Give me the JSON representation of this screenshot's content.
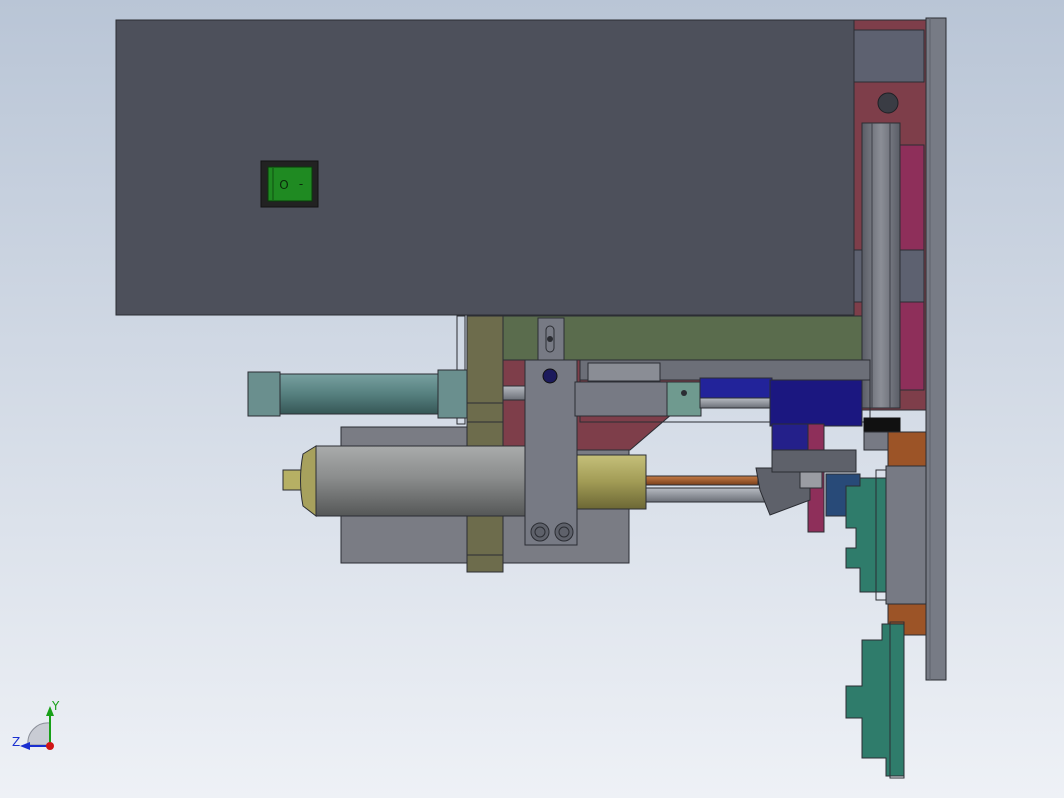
{
  "colors": {
    "background_top": "#b7c3d4",
    "background_bottom": "#eef1f6",
    "housing": "#4d505b",
    "plate": "#777b85",
    "maroon": "#7e3e4a",
    "magenta": "#8e2f5a",
    "olive": "#6d6c4c",
    "green_bar": "#5a6c4d",
    "teal": "#4f7676",
    "cylinder": "#8c8e8e",
    "brass": "#a6a05a",
    "navy": "#1b1780",
    "orange": "#9c5427",
    "sea_green": "#2f7c6b",
    "switch_green": "#1f8a22",
    "axis_x": "#d01515",
    "axis_y": "#18a018",
    "axis_z": "#1a2fd0"
  },
  "triad": {
    "y_label": "Y",
    "z_label": "Z"
  },
  "switch": {
    "icon": "rocker-switch-icon",
    "symbol_on": "O",
    "symbol_off": "-"
  }
}
